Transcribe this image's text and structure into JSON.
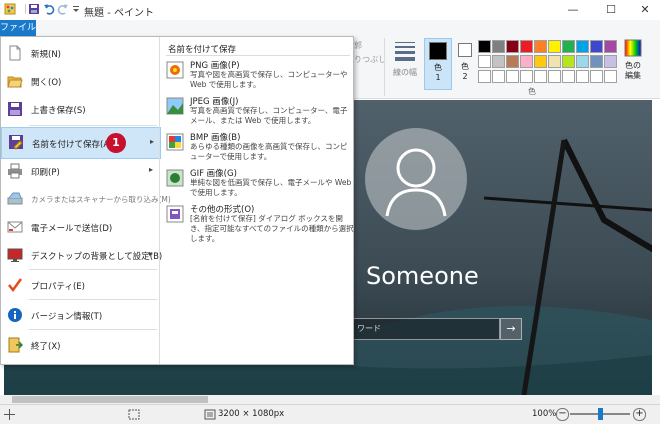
{
  "window": {
    "title": "無題 - ペイント",
    "min": "—",
    "max": "☐",
    "close": "✕"
  },
  "ribbon": {
    "file_tab": "ファイル",
    "line_width_label": "線の幅",
    "color1_label": "色\n1",
    "color2_label": "色\n2",
    "edit_colors_label": "色の\n編集",
    "colors_group_label": "色",
    "partial_label_a": "郭",
    "partial_label_b": "りつぶし",
    "colors": {
      "row1": [
        "#000000",
        "#7f7f7f",
        "#880015",
        "#ed1c24",
        "#ff7f27",
        "#fff200",
        "#22b14c",
        "#00a2e8",
        "#3f48cc",
        "#a349a4"
      ],
      "row2": [
        "#ffffff",
        "#c3c3c3",
        "#b97a57",
        "#ffaec9",
        "#ffc90e",
        "#efe4b0",
        "#b5e61d",
        "#99d9ea",
        "#7092be",
        "#c8bfe7"
      ],
      "row3": [
        "#ffffff",
        "#ffffff",
        "#ffffff",
        "#ffffff",
        "#ffffff",
        "#ffffff",
        "#ffffff",
        "#ffffff",
        "#ffffff",
        "#ffffff"
      ],
      "color1": "#000000",
      "color2": "#ffffff"
    }
  },
  "file_menu": {
    "items": [
      {
        "label": "新規(N)",
        "icon": "new-document-icon",
        "arrow": ""
      },
      {
        "label": "開く(O)",
        "icon": "folder-open-icon",
        "arrow": ""
      },
      {
        "label": "上書き保存(S)",
        "icon": "save-icon",
        "arrow": ""
      },
      {
        "label": "名前を付けて保存(A)",
        "icon": "save-as-icon",
        "arrow": "▸"
      },
      {
        "label": "印刷(P)",
        "icon": "printer-icon",
        "arrow": "▸"
      },
      {
        "label": "カメラまたはスキャナーから取り込み(M)",
        "icon": "scanner-icon",
        "arrow": ""
      },
      {
        "label": "電子メールで送信(D)",
        "icon": "email-icon",
        "arrow": ""
      },
      {
        "label": "デスクトップの背景として設定(B)",
        "icon": "desktop-background-icon",
        "arrow": "▸"
      },
      {
        "label": "プロパティ(E)",
        "icon": "checkmark-icon",
        "arrow": ""
      },
      {
        "label": "バージョン情報(T)",
        "icon": "info-icon",
        "arrow": ""
      },
      {
        "label": "終了(X)",
        "icon": "exit-icon",
        "arrow": ""
      }
    ],
    "step_badge": "1",
    "submenu_title": "名前を付けて保存",
    "submenu": [
      {
        "title": "PNG 画像(P)",
        "desc": "写真や図を高画質で保存し、コンピューターや Web で使用します。"
      },
      {
        "title": "JPEG 画像(J)",
        "desc": "写真を高画質で保存し、コンピューター、電子メール、または Web で使用します。"
      },
      {
        "title": "BMP 画像(B)",
        "desc": "あらゆる種類の画像を高画質で保存し、コンピューターで使用します。"
      },
      {
        "title": "GIF 画像(G)",
        "desc": "単純な図を低画質で保存し、電子メールや Web で使用します。"
      },
      {
        "title": "その他の形式(O)",
        "desc": "[名前を付けて保存] ダイアログ ボックスを開き、指定可能なすべてのファイルの種類から選択します。"
      }
    ]
  },
  "canvas": {
    "user_name": "Someone",
    "password_placeholder": "ワード",
    "submit_arrow": "→"
  },
  "status": {
    "dimensions": "3200 × 1080px",
    "zoom": "100%",
    "zoom_level": 0.5
  }
}
